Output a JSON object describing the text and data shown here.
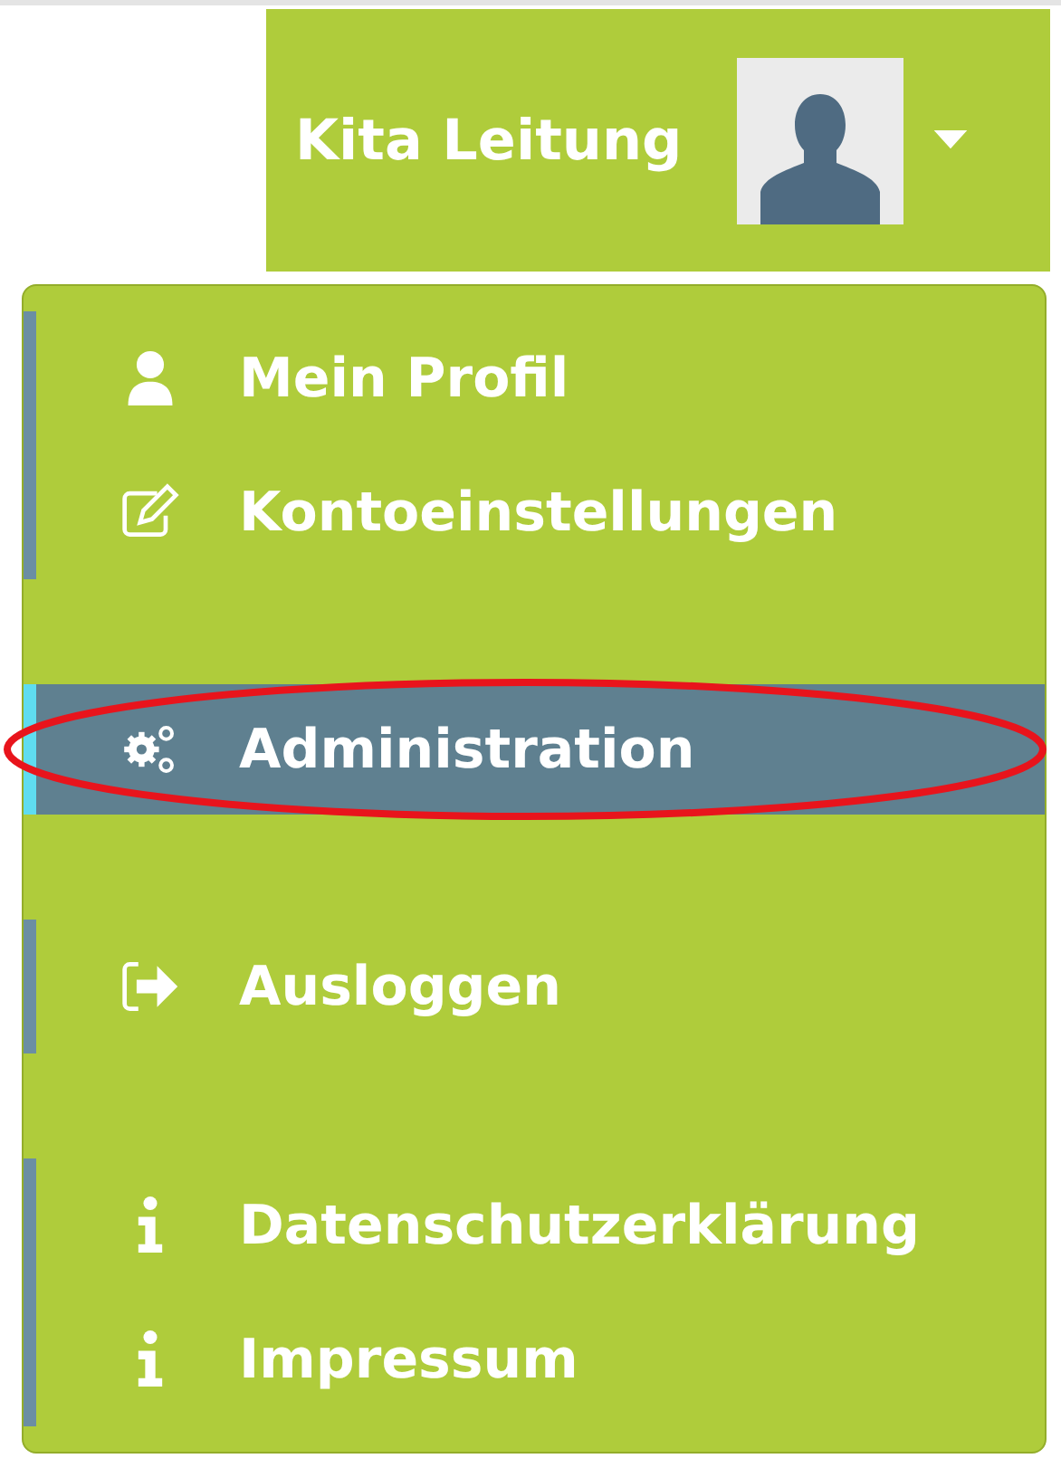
{
  "header": {
    "user_name": "Kita Leitung"
  },
  "menu": {
    "groups": [
      {
        "items": [
          {
            "label": "Mein Profil",
            "kind": "user",
            "selected": false,
            "highlighted": false
          },
          {
            "label": "Kontoeinstellungen",
            "kind": "edit",
            "selected": false,
            "highlighted": false
          }
        ]
      },
      {
        "items": [
          {
            "label": "Administration",
            "kind": "gears",
            "selected": true,
            "highlighted": true
          }
        ]
      },
      {
        "items": [
          {
            "label": "Ausloggen",
            "kind": "logout",
            "selected": false,
            "highlighted": false
          }
        ]
      },
      {
        "items": [
          {
            "label": "Datenschutzerklärung",
            "kind": "info",
            "selected": false,
            "highlighted": false
          },
          {
            "label": "Impressum",
            "kind": "info",
            "selected": false,
            "highlighted": false
          }
        ]
      }
    ]
  }
}
